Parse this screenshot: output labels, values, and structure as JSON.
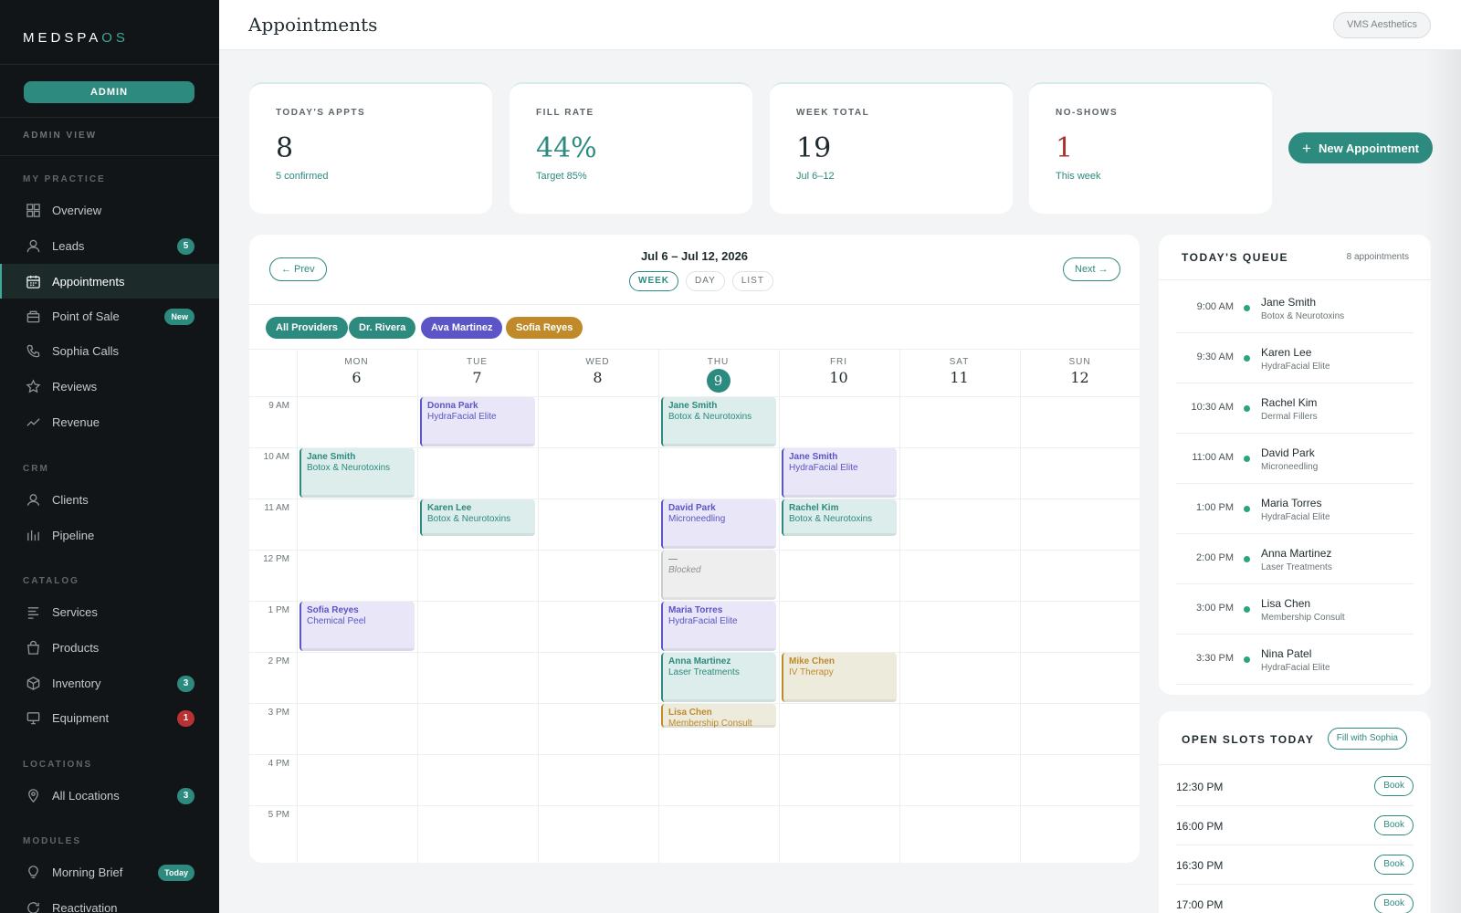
{
  "sidebar": {
    "logo_main": "MEDSPA",
    "logo_accent": "OS",
    "admin_button": "ADMIN",
    "admin_view": "ADMIN VIEW",
    "sections": {
      "practice": "MY PRACTICE",
      "crm": "CRM",
      "catalog": "CATALOG",
      "locations": "LOCATIONS",
      "modules": "MODULES"
    },
    "items": {
      "overview": {
        "label": "Overview",
        "icon": "grid-icon"
      },
      "leads": {
        "label": "Leads",
        "icon": "user-icon",
        "badge": "5"
      },
      "appointments": {
        "label": "Appointments",
        "icon": "calendar-icon"
      },
      "pos": {
        "label": "Point of Sale",
        "icon": "register-icon",
        "badge": "New"
      },
      "calls": {
        "label": "Sophia Calls",
        "icon": "phone-icon"
      },
      "reviews": {
        "label": "Reviews",
        "icon": "star-icon"
      },
      "revenue": {
        "label": "Revenue",
        "icon": "trend-icon"
      },
      "clients": {
        "label": "Clients",
        "icon": "person-icon"
      },
      "pipeline": {
        "label": "Pipeline",
        "icon": "bar-chart-icon"
      },
      "services": {
        "label": "Services",
        "icon": "list-icon"
      },
      "products": {
        "label": "Products",
        "icon": "bag-icon"
      },
      "inventory": {
        "label": "Inventory",
        "icon": "box-icon",
        "badge": "3"
      },
      "equipment": {
        "label": "Equipment",
        "icon": "monitor-icon",
        "badge": "1"
      },
      "all_locations": {
        "label": "All Locations",
        "icon": "pin-icon",
        "badge": "3"
      },
      "morning_brief": {
        "label": "Morning Brief",
        "icon": "bulb-icon",
        "badge": "Today"
      },
      "reactivation": {
        "label": "Reactivation",
        "icon": "refresh-icon"
      }
    }
  },
  "header": {
    "title": "Appointments",
    "clinic": "VMS Aesthetics"
  },
  "stats": [
    {
      "label": "TODAY'S APPTS",
      "value": "8",
      "sub": "5 confirmed"
    },
    {
      "label": "FILL RATE",
      "value": "44%",
      "sub": "Target 85%"
    },
    {
      "label": "WEEK TOTAL",
      "value": "19",
      "sub": "Jul 6–12"
    },
    {
      "label": "NO-SHOWS",
      "value": "1",
      "sub": "This week"
    }
  ],
  "new_appointment": "New Appointment",
  "calendar": {
    "prev": "← Prev",
    "next": "Next →",
    "range": "Jul 6 – Jul 12, 2026",
    "views": [
      "WEEK",
      "DAY",
      "LIST"
    ],
    "providers": [
      "All Providers",
      "Dr. Rivera",
      "Ava Martinez",
      "Sofia Reyes"
    ],
    "days": [
      {
        "name": "MON",
        "date": "6"
      },
      {
        "name": "TUE",
        "date": "7"
      },
      {
        "name": "WED",
        "date": "8"
      },
      {
        "name": "THU",
        "date": "9"
      },
      {
        "name": "FRI",
        "date": "10"
      },
      {
        "name": "SAT",
        "date": "11"
      },
      {
        "name": "SUN",
        "date": "12"
      }
    ],
    "hours": [
      "9 AM",
      "10 AM",
      "11 AM",
      "12 PM",
      "1 PM",
      "2 PM",
      "3 PM",
      "4 PM",
      "5 PM"
    ],
    "events": [
      {
        "day": 0,
        "start": 10.0,
        "end": 11.0,
        "name": "Jane Smith",
        "service": "Botox & Neurotoxins",
        "color": "teal"
      },
      {
        "day": 0,
        "start": 13.0,
        "end": 14.0,
        "name": "Sofia Reyes",
        "service": "Chemical Peel",
        "color": "purple"
      },
      {
        "day": 1,
        "start": 9.0,
        "end": 10.0,
        "name": "Donna Park",
        "service": "HydraFacial Elite",
        "color": "purple"
      },
      {
        "day": 1,
        "start": 11.0,
        "end": 11.75,
        "name": "Karen Lee",
        "service": "Botox & Neurotoxins",
        "color": "teal"
      },
      {
        "day": 3,
        "start": 9.0,
        "end": 10.0,
        "name": "Jane Smith",
        "service": "Botox & Neurotoxins",
        "color": "teal"
      },
      {
        "day": 3,
        "start": 11.0,
        "end": 12.0,
        "name": "David Park",
        "service": "Microneedling",
        "color": "purple"
      },
      {
        "day": 3,
        "start": 12.0,
        "end": 13.0,
        "name": "—",
        "service": "Blocked",
        "color": "grey"
      },
      {
        "day": 3,
        "start": 13.0,
        "end": 14.0,
        "name": "Maria Torres",
        "service": "HydraFacial Elite",
        "color": "purple"
      },
      {
        "day": 3,
        "start": 14.0,
        "end": 15.0,
        "name": "Anna Martinez",
        "service": "Laser Treatments",
        "color": "teal"
      },
      {
        "day": 3,
        "start": 15.0,
        "end": 15.5,
        "name": "Lisa Chen",
        "service": "Membership Consult",
        "color": "gold"
      },
      {
        "day": 4,
        "start": 10.0,
        "end": 11.0,
        "name": "Jane Smith",
        "service": "HydraFacial Elite",
        "color": "purple"
      },
      {
        "day": 4,
        "start": 11.0,
        "end": 11.75,
        "name": "Rachel Kim",
        "service": "Botox & Neurotoxins",
        "color": "teal"
      },
      {
        "day": 4,
        "start": 14.0,
        "end": 15.0,
        "name": "Mike Chen",
        "service": "IV Therapy",
        "color": "gold"
      }
    ]
  },
  "queue": {
    "title": "TODAY'S QUEUE",
    "count": "8 appointments",
    "rows": [
      {
        "time": "9:00 AM",
        "name": "Jane Smith",
        "service": "Botox & Neurotoxins"
      },
      {
        "time": "9:30 AM",
        "name": "Karen Lee",
        "service": "HydraFacial Elite"
      },
      {
        "time": "10:30 AM",
        "name": "Rachel Kim",
        "service": "Dermal Fillers"
      },
      {
        "time": "11:00 AM",
        "name": "David Park",
        "service": "Microneedling"
      },
      {
        "time": "1:00 PM",
        "name": "Maria Torres",
        "service": "HydraFacial Elite"
      },
      {
        "time": "2:00 PM",
        "name": "Anna Martinez",
        "service": "Laser Treatments"
      },
      {
        "time": "3:00 PM",
        "name": "Lisa Chen",
        "service": "Membership Consult"
      },
      {
        "time": "3:30 PM",
        "name": "Nina Patel",
        "service": "HydraFacial Elite"
      }
    ]
  },
  "slots": {
    "title": "OPEN SLOTS TODAY",
    "fill_button": "Fill with Sophia",
    "book_label": "Book",
    "times": [
      "12:30 PM",
      "16:00 PM",
      "16:30 PM",
      "17:00 PM"
    ]
  },
  "colors": {
    "accent": "#2d8a7e",
    "sidebar_bg": "#121517",
    "provider_teal": "#2d8a7e",
    "provider_purple": "#5b55c8",
    "provider_gold": "#c08a2a",
    "danger": "#b83234"
  }
}
